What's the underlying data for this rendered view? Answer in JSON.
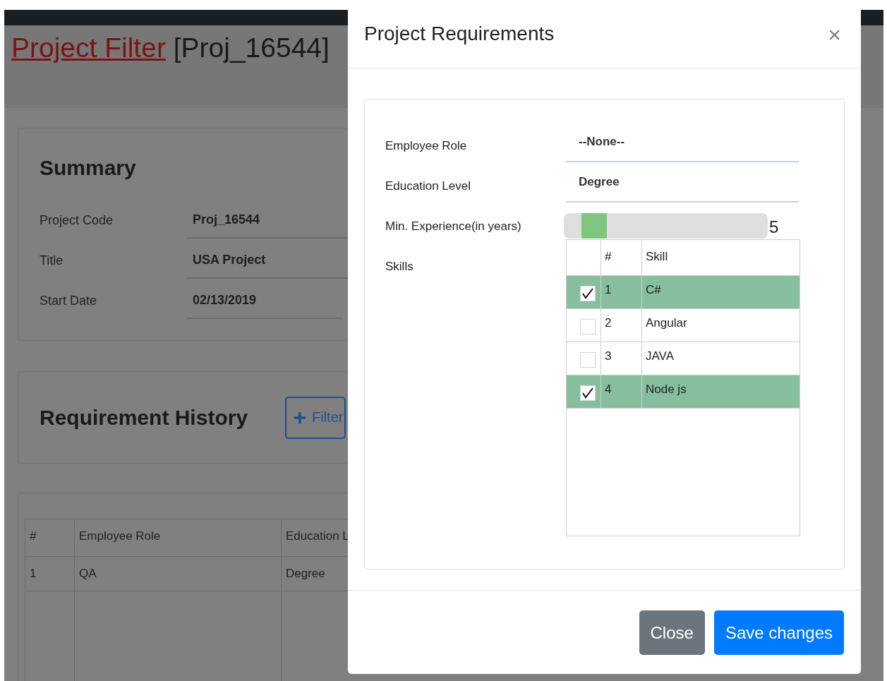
{
  "page": {
    "title_link": "Project Filter",
    "title_code": "[Proj_16544]"
  },
  "summary": {
    "heading": "Summary",
    "fields": [
      {
        "label": "Project Code",
        "value": "Proj_16544"
      },
      {
        "label": "Title",
        "value": "USA Project"
      },
      {
        "label": "Start Date",
        "value": "02/13/2019"
      }
    ]
  },
  "requirement_history": {
    "heading": "Requirement History",
    "filter_button": "Filter"
  },
  "history_table": {
    "columns": [
      "#",
      "Employee Role",
      "Education L"
    ],
    "rows": [
      [
        "1",
        "QA",
        "Degree"
      ]
    ]
  },
  "modal": {
    "title": "Project Requirements",
    "close": "×",
    "fields": [
      {
        "kind": "select",
        "label": "Employee Role",
        "value": "--None--"
      },
      {
        "kind": "select",
        "label": "Education Level",
        "value": "Degree"
      },
      {
        "kind": "slider",
        "label": "Min. Experience(in years)",
        "level": 0.1,
        "reading": "5"
      },
      {
        "kind": "table",
        "label": "Skills"
      }
    ],
    "skills": {
      "columns": [
        "#",
        "Skill"
      ],
      "rows": [
        {
          "checked": true,
          "number": "1",
          "skill": "C#"
        },
        {
          "checked": false,
          "number": "2",
          "skill": "Angular"
        },
        {
          "checked": false,
          "number": "3",
          "skill": "JAVA"
        },
        {
          "checked": true,
          "number": "4",
          "skill": "Node js"
        }
      ]
    },
    "buttons": [
      {
        "kind": "secondary",
        "label": "Close"
      },
      {
        "kind": "primary",
        "label": "Save changes"
      }
    ]
  }
}
